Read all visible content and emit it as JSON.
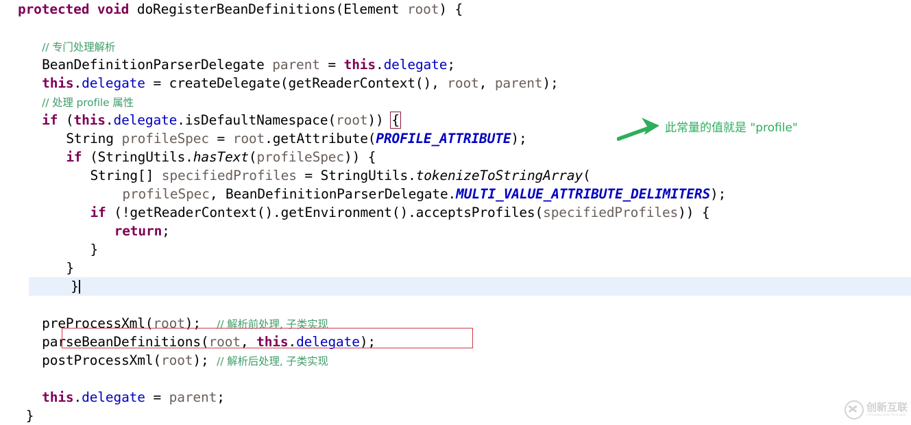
{
  "editor": {
    "language": "java",
    "background": "#ffffff",
    "current_line_highlight": "#e8f0fb",
    "caret_line_index": 12,
    "theme_colors": {
      "keyword": "#7f0055",
      "field": "#0000c0",
      "static_final_field": "#0000c0",
      "local_variable": "#6a5f5a",
      "comment": "#3f9e6b",
      "plain_text": "#000000",
      "brace_match_outline": "#8b1a3a",
      "annotation_green": "#2eae5c",
      "highlight_box_red": "#d1384a"
    },
    "lines": [
      {
        "n": 1,
        "indent": 0,
        "tokens": [
          {
            "t": "protected",
            "c": "kw"
          },
          {
            "t": " ",
            "c": "plain"
          },
          {
            "t": "void",
            "c": "kw"
          },
          {
            "t": " ",
            "c": "plain"
          },
          {
            "t": "doRegisterBeanDefinitions",
            "c": "plain"
          },
          {
            "t": "(",
            "c": "plain"
          },
          {
            "t": "Element",
            "c": "plain"
          },
          {
            "t": " ",
            "c": "plain"
          },
          {
            "t": "root",
            "c": "param"
          },
          {
            "t": ") {",
            "c": "plain"
          }
        ]
      },
      {
        "n": 2,
        "indent": 0,
        "tokens": []
      },
      {
        "n": 3,
        "indent": 3,
        "tokens": [
          {
            "t": "// 专门处理解析",
            "c": "cmt-cn"
          }
        ]
      },
      {
        "n": 4,
        "indent": 3,
        "tokens": [
          {
            "t": "BeanDefinitionParserDelegate",
            "c": "plain"
          },
          {
            "t": " ",
            "c": "plain"
          },
          {
            "t": "parent",
            "c": "var"
          },
          {
            "t": " = ",
            "c": "plain"
          },
          {
            "t": "this",
            "c": "kw"
          },
          {
            "t": ".",
            "c": "plain"
          },
          {
            "t": "delegate",
            "c": "fld"
          },
          {
            "t": ";",
            "c": "plain"
          }
        ]
      },
      {
        "n": 5,
        "indent": 3,
        "tokens": [
          {
            "t": "this",
            "c": "kw"
          },
          {
            "t": ".",
            "c": "plain"
          },
          {
            "t": "delegate",
            "c": "fld"
          },
          {
            "t": " = createDelegate(getReaderContext(), ",
            "c": "plain"
          },
          {
            "t": "root",
            "c": "var"
          },
          {
            "t": ", ",
            "c": "plain"
          },
          {
            "t": "parent",
            "c": "var"
          },
          {
            "t": ");",
            "c": "plain"
          }
        ]
      },
      {
        "n": 6,
        "indent": 3,
        "tokens": [
          {
            "t": "// 处理 profile 属性",
            "c": "cmt-cn"
          }
        ]
      },
      {
        "n": 7,
        "indent": 3,
        "tokens": [
          {
            "t": "if",
            "c": "kw"
          },
          {
            "t": " (",
            "c": "plain"
          },
          {
            "t": "this",
            "c": "kw"
          },
          {
            "t": ".",
            "c": "plain"
          },
          {
            "t": "delegate",
            "c": "fld"
          },
          {
            "t": ".isDefaultNamespace(",
            "c": "plain"
          },
          {
            "t": "root",
            "c": "var"
          },
          {
            "t": ")) ",
            "c": "plain"
          },
          {
            "t": "{",
            "c": "plain",
            "box": true
          }
        ]
      },
      {
        "n": 8,
        "indent": 6,
        "tokens": [
          {
            "t": "String",
            "c": "plain"
          },
          {
            "t": " ",
            "c": "plain"
          },
          {
            "t": "profileSpec",
            "c": "var"
          },
          {
            "t": " = ",
            "c": "plain"
          },
          {
            "t": "root",
            "c": "var"
          },
          {
            "t": ".getAttribute(",
            "c": "plain"
          },
          {
            "t": "PROFILE_ATTRIBUTE",
            "c": "sfld"
          },
          {
            "t": ");",
            "c": "plain"
          }
        ]
      },
      {
        "n": 9,
        "indent": 6,
        "tokens": [
          {
            "t": "if",
            "c": "kw"
          },
          {
            "t": " (StringUtils.",
            "c": "plain"
          },
          {
            "t": "hasText",
            "c": "smeth"
          },
          {
            "t": "(",
            "c": "plain"
          },
          {
            "t": "profileSpec",
            "c": "var"
          },
          {
            "t": ")) {",
            "c": "plain"
          }
        ]
      },
      {
        "n": 10,
        "indent": 9,
        "tokens": [
          {
            "t": "String[]",
            "c": "plain"
          },
          {
            "t": " ",
            "c": "plain"
          },
          {
            "t": "specifiedProfiles",
            "c": "var"
          },
          {
            "t": " = StringUtils.",
            "c": "plain"
          },
          {
            "t": "tokenizeToStringArray",
            "c": "smeth"
          },
          {
            "t": "(",
            "c": "plain"
          }
        ]
      },
      {
        "n": 11,
        "indent": 13,
        "tokens": [
          {
            "t": "profileSpec",
            "c": "var"
          },
          {
            "t": ", BeanDefinitionParserDelegate.",
            "c": "plain"
          },
          {
            "t": "MULTI_VALUE_ATTRIBUTE_DELIMITERS",
            "c": "sfld"
          },
          {
            "t": ");",
            "c": "plain"
          }
        ]
      },
      {
        "n": 12,
        "indent": 9,
        "tokens": [
          {
            "t": "if",
            "c": "kw"
          },
          {
            "t": " (!getReaderContext().getEnvironment().acceptsProfiles(",
            "c": "plain"
          },
          {
            "t": "specifiedProfiles",
            "c": "var"
          },
          {
            "t": ")) {",
            "c": "plain"
          }
        ]
      },
      {
        "n": 13,
        "indent": 12,
        "tokens": [
          {
            "t": "return",
            "c": "kw"
          },
          {
            "t": ";",
            "c": "plain"
          }
        ]
      },
      {
        "n": 14,
        "indent": 9,
        "tokens": [
          {
            "t": "}",
            "c": "plain"
          }
        ]
      },
      {
        "n": 15,
        "indent": 6,
        "tokens": [
          {
            "t": "}",
            "c": "plain"
          }
        ]
      },
      {
        "n": 16,
        "indent": 3,
        "current": true,
        "caret": true,
        "tokens": [
          {
            "t": "}",
            "c": "plain"
          }
        ]
      },
      {
        "n": 17,
        "indent": 0,
        "tokens": []
      },
      {
        "n": 18,
        "indent": 3,
        "tokens": [
          {
            "t": "preProcessXml(",
            "c": "plain"
          },
          {
            "t": "root",
            "c": "var"
          },
          {
            "t": ");",
            "c": "plain"
          },
          {
            "t": "  ",
            "c": "plain"
          },
          {
            "t": "// 解析前处理, 子类实现",
            "c": "cmt-cn"
          }
        ]
      },
      {
        "n": 19,
        "indent": 3,
        "tokens": [
          {
            "t": "parseBeanDefinitions(",
            "c": "plain"
          },
          {
            "t": "root",
            "c": "var"
          },
          {
            "t": ", ",
            "c": "plain"
          },
          {
            "t": "this",
            "c": "kw"
          },
          {
            "t": ".",
            "c": "plain"
          },
          {
            "t": "delegate",
            "c": "fld"
          },
          {
            "t": ");",
            "c": "plain"
          }
        ]
      },
      {
        "n": 20,
        "indent": 3,
        "tokens": [
          {
            "t": "postProcessXml(",
            "c": "plain"
          },
          {
            "t": "root",
            "c": "var"
          },
          {
            "t": ");",
            "c": "plain"
          },
          {
            "t": " ",
            "c": "plain"
          },
          {
            "t": "// 解析后处理, 子类实现",
            "c": "cmt-cn"
          }
        ]
      },
      {
        "n": 21,
        "indent": 0,
        "tokens": []
      },
      {
        "n": 22,
        "indent": 3,
        "tokens": [
          {
            "t": "this",
            "c": "kw"
          },
          {
            "t": ".",
            "c": "plain"
          },
          {
            "t": "delegate",
            "c": "fld"
          },
          {
            "t": " = ",
            "c": "plain"
          },
          {
            "t": "parent",
            "c": "var"
          },
          {
            "t": ";",
            "c": "plain"
          }
        ]
      },
      {
        "n": 23,
        "indent": 1,
        "tokens": [
          {
            "t": "}",
            "c": "plain"
          }
        ]
      }
    ]
  },
  "annotation": {
    "text": "此常量的值就是 \"profile\"",
    "color": "#2eae5c",
    "arrow": "arrow-right"
  },
  "highlight_box": {
    "label": "parseBeanDefinitions-highlight",
    "color": "#d1384a"
  },
  "watermark": {
    "cn": "创新互联",
    "en": "CHUANGXIN HULIAN",
    "icon": "circled-x-logo"
  }
}
